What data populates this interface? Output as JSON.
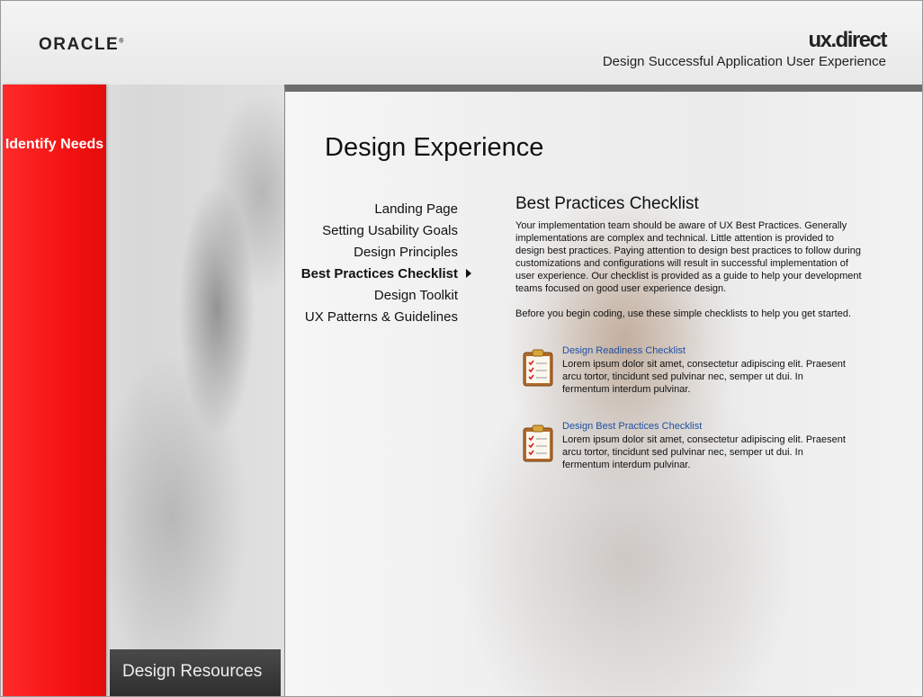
{
  "header": {
    "oracle_logo": "ORACLE",
    "brand_ux": "ux",
    "brand_direct": "direct",
    "tagline": "Design Successful Application User Experience"
  },
  "sidebar": {
    "identify_needs": "Identify Needs",
    "design_resources": "Design Resources"
  },
  "main": {
    "page_title": "Design Experience",
    "nav": [
      {
        "label": "Landing Page",
        "active": false
      },
      {
        "label": "Setting Usability Goals",
        "active": false
      },
      {
        "label": "Design Principles",
        "active": false
      },
      {
        "label": "Best Practices Checklist",
        "active": true
      },
      {
        "label": "Design Toolkit",
        "active": false
      },
      {
        "label": "UX Patterns & Guidelines",
        "active": false
      }
    ],
    "section_title": "Best Practices Checklist",
    "intro": "Your implementation team should be aware of UX Best Practices. Generally implementations are complex and technical. Little attention is provided to design best practices. Paying attention to design best practices to follow during customizations and configurations will result in successful implementation of user experience. Our checklist is provided as a guide to help your development teams focused on good user experience design.",
    "before": "Before you begin coding, use these simple checklists to help you get started.",
    "checklists": [
      {
        "title": "Design Readiness Checklist",
        "description": "Lorem ipsum dolor sit amet, consectetur adipiscing elit. Praesent arcu tortor, tincidunt sed pulvinar nec, semper ut dui. In fermentum interdum pulvinar."
      },
      {
        "title": "Design Best Practices Checklist",
        "description": "Lorem ipsum dolor sit amet, consectetur adipiscing elit. Praesent arcu tortor, tincidunt sed pulvinar nec, semper ut dui. In fermentum interdum pulvinar."
      }
    ]
  },
  "icons": {
    "arrow": "caret-right-icon",
    "checklist": "clipboard-checklist-icon"
  },
  "colors": {
    "accent_red": "#f51313",
    "link_blue": "#1f4fa3",
    "dark_tab": "#333333"
  }
}
